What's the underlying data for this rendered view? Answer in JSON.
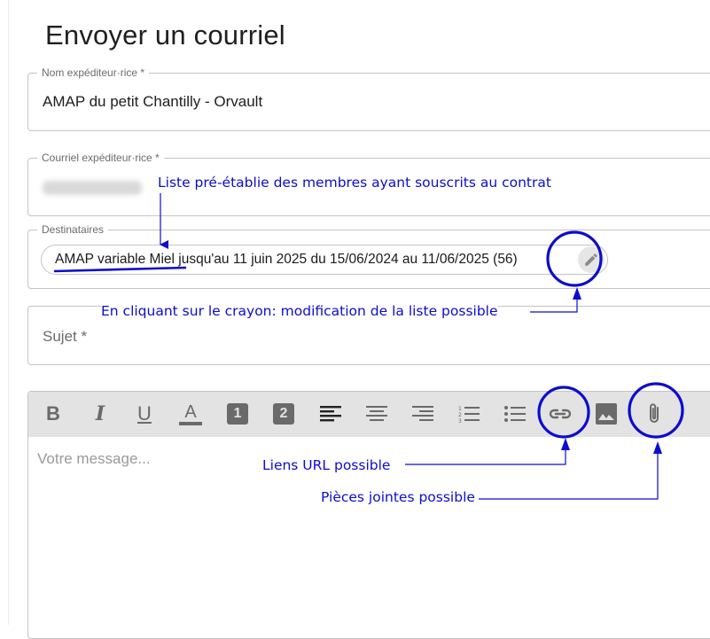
{
  "page": {
    "title": "Envoyer un courriel"
  },
  "sender_name": {
    "label": "Nom expéditeur·rice *",
    "value": "AMAP du petit Chantilly - Orvault"
  },
  "sender_email": {
    "label": "Courriel expéditeur·rice *"
  },
  "recipients": {
    "label": "Destinataires",
    "chip": "AMAP variable Miel jusqu'au 11 juin 2025 du 15/06/2024 au 11/06/2025 (56)"
  },
  "subject": {
    "placeholder": "Sujet *"
  },
  "editor": {
    "placeholder": "Votre message...",
    "toolbar": [
      {
        "name": "bold-icon",
        "glyph": "B"
      },
      {
        "name": "italic-icon",
        "glyph": "I"
      },
      {
        "name": "underline-icon",
        "glyph": "U"
      },
      {
        "name": "text-color-icon",
        "glyph": "A"
      },
      {
        "name": "heading-1-icon",
        "glyph": "1"
      },
      {
        "name": "heading-2-icon",
        "glyph": "2"
      },
      {
        "name": "align-left-icon",
        "glyph": ""
      },
      {
        "name": "align-center-icon",
        "glyph": ""
      },
      {
        "name": "align-right-icon",
        "glyph": ""
      },
      {
        "name": "ordered-list-icon",
        "glyph": ""
      },
      {
        "name": "bullet-list-icon",
        "glyph": ""
      },
      {
        "name": "link-icon",
        "glyph": ""
      },
      {
        "name": "image-icon",
        "glyph": ""
      },
      {
        "name": "attachment-icon",
        "glyph": ""
      }
    ]
  },
  "annotations": {
    "recipients_list": "Liste pré-établie des membres ayant souscrits au contrat",
    "edit_pencil": "En cliquant sur le crayon: modification de la liste possible",
    "links": "Liens URL possible",
    "attachments": "Pièces jointes possible",
    "color": "#0c0ccf"
  }
}
